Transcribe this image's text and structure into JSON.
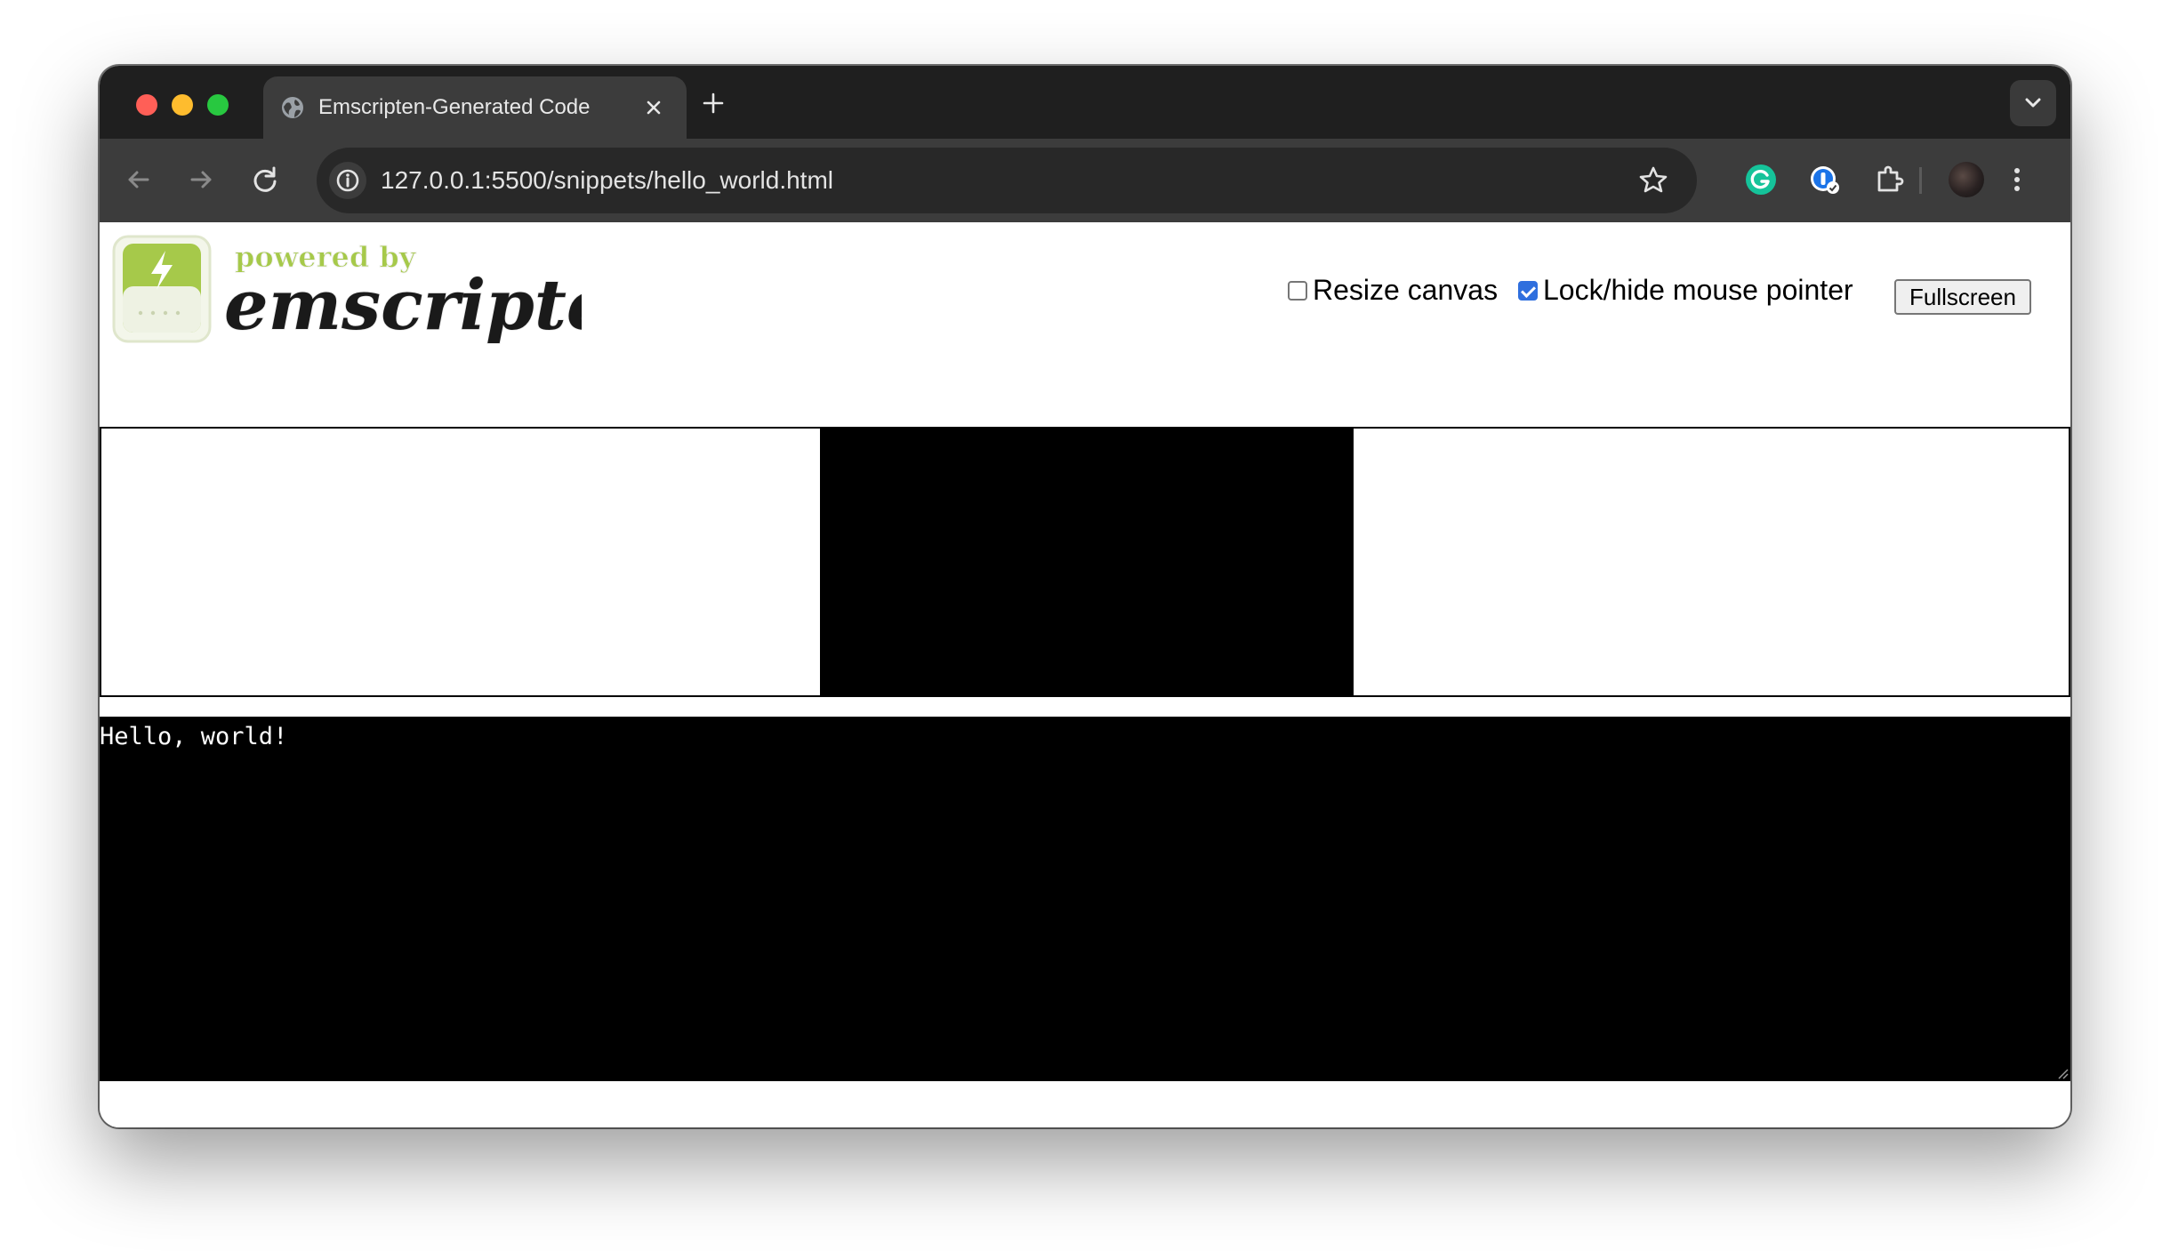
{
  "browser": {
    "tab": {
      "title": "Emscripten-Generated Code",
      "favicon": "globe-icon"
    },
    "address_bar": {
      "url": "127.0.0.1:5500/snippets/hello_world.html"
    },
    "toolbar_icons": [
      "back-arrow-icon",
      "forward-arrow-icon",
      "reload-icon",
      "site-info-icon",
      "bookmark-star-icon",
      "grammarly-extension-icon",
      "password-manager-extension-icon",
      "extensions-puzzle-icon",
      "profile-avatar",
      "more-menu-icon"
    ]
  },
  "page": {
    "logo": {
      "tagline": "powered by",
      "name": "emscripten"
    },
    "controls": {
      "resize_canvas_label": "Resize canvas",
      "resize_canvas_checked": false,
      "lock_pointer_label": "Lock/hide mouse pointer",
      "lock_pointer_checked": true,
      "fullscreen_label": "Fullscreen"
    },
    "output_text": "Hello, world!"
  },
  "colors": {
    "titlebar": "#1f1f1f",
    "toolbar": "#3c3c3c",
    "omnibox": "#282828",
    "logo_green": "#a6c94a",
    "checkbox_accent": "#2f6fde"
  }
}
